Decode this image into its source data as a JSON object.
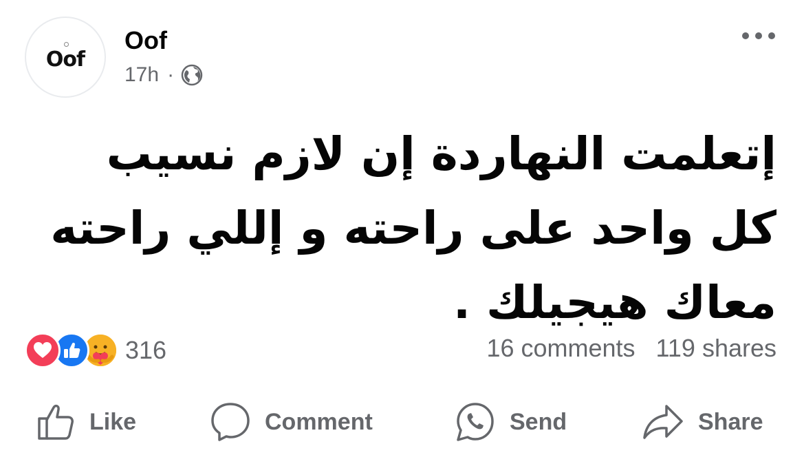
{
  "post": {
    "page_name": "Oof",
    "avatar_logo": "Oof",
    "time": "17h",
    "separator": "·",
    "audience_icon": "globe-icon",
    "text": "إتعلمت النهاردة إن لازم نسيب كل واحد على راحته و إللي راحته معاك هيجيلك ."
  },
  "engagement": {
    "reaction_icons": [
      "love-icon",
      "like-icon",
      "care-icon"
    ],
    "reaction_count": "316",
    "comments": "16 comments",
    "shares": "119 shares"
  },
  "actions": {
    "like_label": "Like",
    "comment_label": "Comment",
    "send_label": "Send",
    "share_label": "Share"
  },
  "colors": {
    "text": "#050505",
    "secondary": "#65676b",
    "love": "#f33e58",
    "like": "#1877f2",
    "care": "#f7b125"
  }
}
